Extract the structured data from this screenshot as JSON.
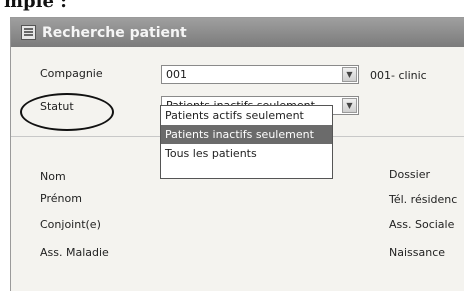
{
  "caption_text": "mple :",
  "window": {
    "title": "Recherche patient"
  },
  "form": {
    "compagnie": {
      "label": "Compagnie",
      "value": "001",
      "suffix": "001- clinic"
    },
    "statut": {
      "label": "Statut",
      "value": "Patients inactifs seulement"
    },
    "statut_options": [
      "Patients actifs seulement",
      "Patients inactifs seulement",
      "Tous les patients"
    ],
    "left_fields": [
      "Nom",
      "Prénom",
      "Conjoint(e)",
      "Ass. Maladie"
    ],
    "right_fields": [
      "Dossier",
      "Tél. résidenc",
      "Ass. Sociale",
      "Naissance"
    ]
  },
  "icons": {
    "title_icon": "search-patient-icon",
    "combo_arrow": "chevron-down-icon"
  }
}
